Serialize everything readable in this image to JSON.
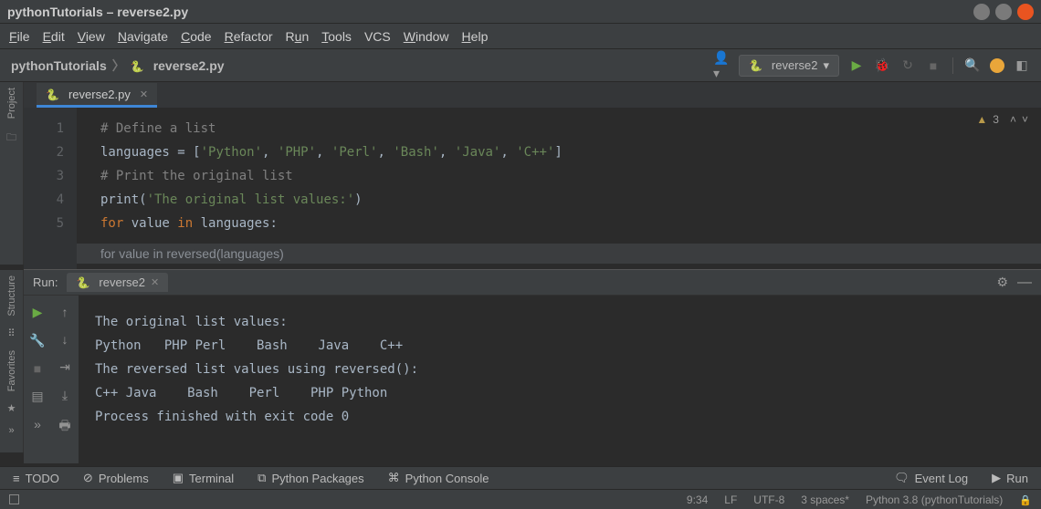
{
  "window": {
    "title": "pythonTutorials – reverse2.py"
  },
  "menu": [
    "File",
    "Edit",
    "View",
    "Navigate",
    "Code",
    "Refactor",
    "Run",
    "Tools",
    "VCS",
    "Window",
    "Help"
  ],
  "breadcrumb": {
    "project": "pythonTutorials",
    "file": "reverse2.py"
  },
  "run_config": {
    "name": "reverse2"
  },
  "left_tabs": {
    "project": "Project",
    "structure": "Structure",
    "favorites": "Favorites"
  },
  "editor": {
    "tab_name": "reverse2.py",
    "gutter": [
      1,
      2,
      3,
      4,
      5
    ],
    "lines": [
      {
        "t": "# Define a list",
        "cls": "cmt"
      },
      {
        "t": "languages = ['Python', 'PHP', 'Perl', 'Bash', 'Java', 'C++']",
        "cls": "assign"
      },
      {
        "t": "# Print the original list",
        "cls": "cmt"
      },
      {
        "t": "print('The original list values:')",
        "cls": "print"
      },
      {
        "t": "for value in languages:",
        "cls": "for"
      }
    ],
    "hint": "for value in reversed(languages)",
    "warn_count": "3"
  },
  "run": {
    "label": "Run:",
    "tab": "reverse2",
    "output": [
      "The original list values:",
      "Python   PHP Perl    Bash    Java    C++",
      "The reversed list values using reversed():",
      "C++ Java    Bash    Perl    PHP Python",
      "Process finished with exit code 0"
    ]
  },
  "bottom_tools": {
    "todo": "TODO",
    "problems": "Problems",
    "terminal": "Terminal",
    "packages": "Python Packages",
    "console": "Python Console",
    "eventlog": "Event Log",
    "run": "Run"
  },
  "status": {
    "pos": "9:34",
    "le": "LF",
    "enc": "UTF-8",
    "indent": "3 spaces*",
    "interpreter": "Python 3.8 (pythonTutorials)"
  }
}
